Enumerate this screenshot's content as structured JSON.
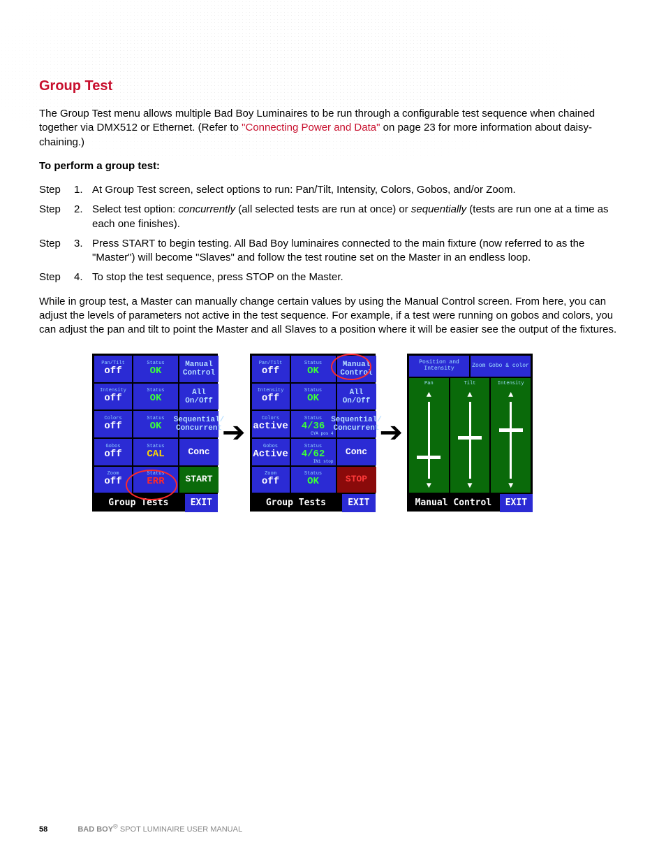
{
  "heading": "Group Test",
  "intro_a": "The Group Test menu allows multiple Bad Boy Luminaires to be run through a configurable test sequence when chained together via DMX512 or Ethernet. (Refer to ",
  "intro_link": "\"Connecting Power and Data\"",
  "intro_b": " on page 23 for more information about daisy-chaining.)",
  "perform": "To perform a group test:",
  "steps": [
    {
      "n": "1.",
      "t": "At Group Test screen, select options to run: Pan/Tilt, Intensity, Colors, Gobos, and/or Zoom."
    },
    {
      "n": "2.",
      "t": "Select test option: concurrently (all selected tests are run at once) or sequentially (tests are run one at a time as each one finishes).",
      "em": [
        "concurrently",
        "sequentially"
      ]
    },
    {
      "n": "3.",
      "t": "Press START to begin testing. All Bad Boy luminaires connected to the main fixture (now referred to as the \"Master\") will become \"Slaves\" and follow the test routine set on the Master in an endless loop."
    },
    {
      "n": "4.",
      "t": "To stop the test sequence, press STOP on the Master."
    }
  ],
  "para2": "While in group test, a Master can manually change certain values by using the Manual Control screen. From here, you can adjust the levels of parameters not active in the test sequence. For example, if a test were running on gobos and colors, you can adjust the pan and tilt to point the Master and all Slaves to a position where it will be easier see the output of the fixtures.",
  "screen1": {
    "rows": [
      {
        "l": "Pan/Tilt",
        "v": "off",
        "s": "OK",
        "sc": "ok"
      },
      {
        "l": "Intensity",
        "v": "off",
        "s": "OK",
        "sc": "ok"
      },
      {
        "l": "Colors",
        "v": "off",
        "s": "OK",
        "sc": "ok"
      },
      {
        "l": "Gobos",
        "v": "off",
        "s": "CAL",
        "sc": "cal"
      },
      {
        "l": "Zoom",
        "v": "off",
        "s": "ERR",
        "sc": "err"
      }
    ],
    "btns": [
      "Manual Control",
      "All On/Off",
      "Sequential/ Concurrent",
      "Conc",
      "START"
    ],
    "title": "Group Tests",
    "exit": "EXIT"
  },
  "screen2": {
    "rows": [
      {
        "l": "Pan/Tilt",
        "v": "off",
        "s": "OK",
        "sc": "ok"
      },
      {
        "l": "Intensity",
        "v": "off",
        "s": "OK",
        "sc": "ok"
      },
      {
        "l": "Colors",
        "v": "active",
        "s": "4/36",
        "sc": "ok",
        "sub": "CYA pos 4"
      },
      {
        "l": "Gobos",
        "v": "Active",
        "s": "4/62",
        "sc": "ok",
        "sub": "IN1 stop"
      },
      {
        "l": "Zoom",
        "v": "off",
        "s": "OK",
        "sc": "ok"
      }
    ],
    "btns": [
      "Manual Control",
      "All On/Off",
      "Sequential/ Concurrent",
      "Conc",
      "STOP"
    ],
    "title": "Group Tests",
    "exit": "EXIT"
  },
  "screen3": {
    "heads": [
      "Position and Intensity",
      "Zoom Gobo & color"
    ],
    "sliders": [
      {
        "l": "Pan",
        "pos": 70
      },
      {
        "l": "Tilt",
        "pos": 45
      },
      {
        "l": "Intensity",
        "pos": 35
      }
    ],
    "title": "Manual Control",
    "exit": "EXIT"
  },
  "footer": {
    "page": "58",
    "manual": "BAD BOY",
    "reg": "®",
    "manual2": " SPOT LUMINAIRE USER MANUAL"
  }
}
